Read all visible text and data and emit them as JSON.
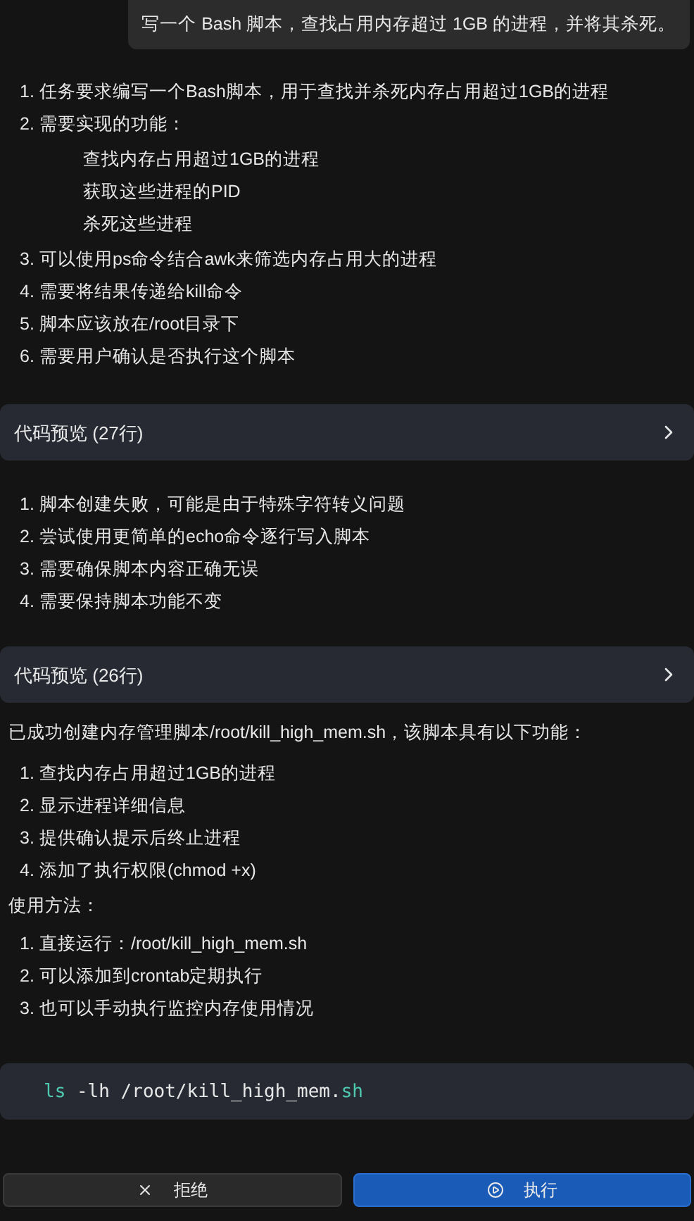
{
  "user_message": "写一个 Bash 脚本，查找占用内存超过 1GB 的进程，并将其杀死。",
  "blocks": [
    {
      "kind": "list",
      "items": [
        {
          "number": "1.",
          "text": "任务要求编写一个Bash脚本，用于查找并杀死内存占用超过1GB的进程"
        },
        {
          "number": "2.",
          "text": "需要实现的功能：",
          "children": [
            {
              "text": "查找内存占用超过1GB的进程"
            },
            {
              "text": "获取这些进程的PID"
            },
            {
              "text": "杀死这些进程"
            }
          ]
        },
        {
          "number": "3.",
          "text": "可以使用ps命令结合awk来筛选内存占用大的进程"
        },
        {
          "number": "4.",
          "text": "需要将结果传递给kill命令"
        },
        {
          "number": "5.",
          "text": "脚本应该放在/root目录下"
        },
        {
          "number": "6.",
          "text": "需要用户确认是否执行这个脚本"
        }
      ]
    },
    {
      "kind": "preview",
      "label": "代码预览 (27行)",
      "expanded": false
    },
    {
      "kind": "list",
      "items": [
        {
          "number": "1.",
          "text": "脚本创建失败，可能是由于特殊字符转义问题"
        },
        {
          "number": "2.",
          "text": "尝试使用更简单的echo命令逐行写入脚本"
        },
        {
          "number": "3.",
          "text": "需要确保脚本内容正确无误"
        },
        {
          "number": "4.",
          "text": "需要保持脚本功能不变"
        }
      ]
    },
    {
      "kind": "preview",
      "label": "代码预览 (26行)",
      "expanded": false
    },
    {
      "kind": "paragraph",
      "text": "已成功创建内存管理脚本/root/kill_high_mem.sh，该脚本具有以下功能："
    },
    {
      "kind": "list",
      "items": [
        {
          "number": "1.",
          "text": "查找内存占用超过1GB的进程"
        },
        {
          "number": "2.",
          "text": "显示进程详细信息"
        },
        {
          "number": "3.",
          "text": "提供确认提示后终止进程"
        },
        {
          "number": "4.",
          "text": "添加了执行权限(chmod +x)"
        }
      ]
    },
    {
      "kind": "paragraph",
      "text": "使用方法："
    },
    {
      "kind": "list",
      "items": [
        {
          "number": "1.",
          "text": "直接运行：/root/kill_high_mem.sh"
        },
        {
          "number": "2.",
          "text": "可以添加到crontab定期执行"
        },
        {
          "number": "3.",
          "text": "也可以手动执行监控内存使用情况"
        }
      ]
    },
    {
      "kind": "code",
      "tokens": [
        {
          "text": "ls",
          "kind": "command"
        },
        {
          "text": " -lh /root/kill_high_mem.",
          "kind": "plain"
        },
        {
          "text": "sh",
          "kind": "command"
        }
      ]
    }
  ],
  "actions": [
    {
      "label": "拒绝",
      "kind": "reject"
    },
    {
      "label": "执行",
      "kind": "run"
    }
  ]
}
